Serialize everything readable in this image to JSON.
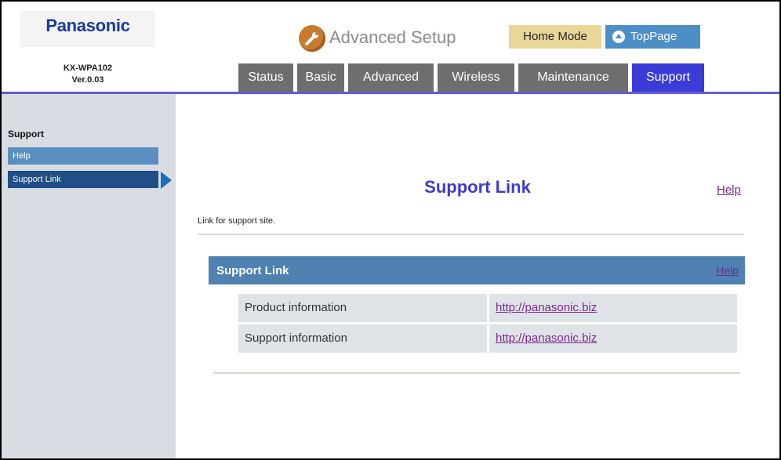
{
  "header": {
    "brand": "Panasonic",
    "model_line1": "KX-WPA102",
    "model_line2": "Ver.0.03",
    "setup_title": "Advanced Setup",
    "home_mode_label": "Home Mode",
    "toppage_label": "TopPage"
  },
  "tabs": [
    {
      "label": "Status",
      "active": false
    },
    {
      "label": "Basic",
      "active": false
    },
    {
      "label": "Advanced",
      "active": false
    },
    {
      "label": "Wireless",
      "active": false
    },
    {
      "label": "Maintenance",
      "active": false
    },
    {
      "label": "Support",
      "active": true
    }
  ],
  "sidebar": {
    "heading": "Support",
    "items": [
      {
        "label": "Help",
        "active": false
      },
      {
        "label": "Support Link",
        "active": true
      }
    ]
  },
  "main": {
    "title": "Support Link",
    "help_link": "Help",
    "description": "Link for support site.",
    "section": {
      "title": "Support Link",
      "help_link": "Help",
      "rows": [
        {
          "label": "Product information",
          "link": "http://panasonic.biz"
        },
        {
          "label": "Support information",
          "link": "http://panasonic.biz"
        }
      ]
    }
  },
  "colors": {
    "brand": "#1a3b9c",
    "active_tab": "#3b3bd8",
    "inactive_tab": "#6e6e6e",
    "section_bar": "#4f81b3",
    "link": "#7a2a8a",
    "home_mode_bg": "#e9d79a",
    "toppage_bg": "#4c8fc6"
  },
  "icons": {
    "setup": "wrench-icon",
    "toppage": "up-arrow-circle-icon",
    "sidebar_pointer": "triangle-right-icon"
  }
}
